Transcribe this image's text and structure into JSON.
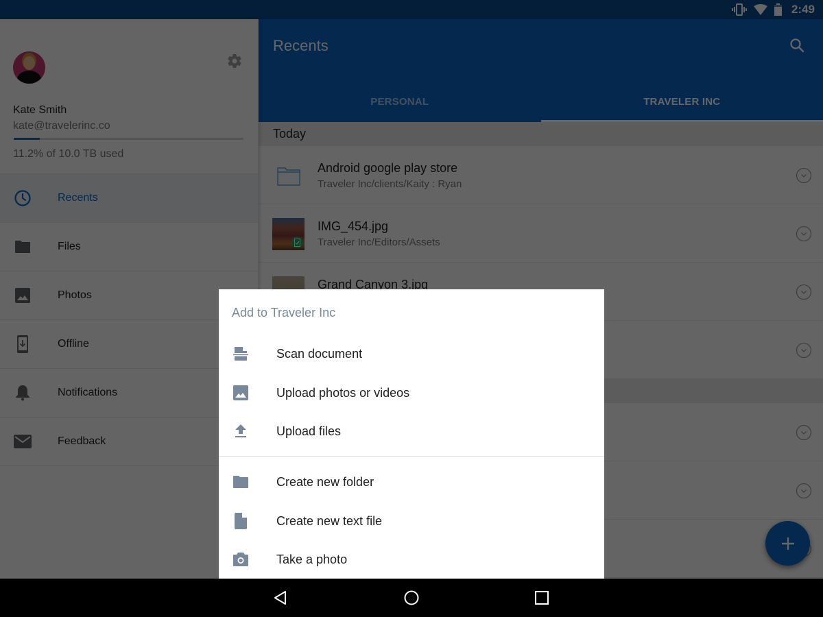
{
  "status_bar": {
    "time": "2:49",
    "icons": [
      "vibrate-icon",
      "wifi-icon",
      "battery-icon"
    ]
  },
  "sidebar": {
    "user": {
      "name": "Kate Smith",
      "email": "kate@travelerinc.co",
      "storage_text": "11.2% of 10.0 TB used",
      "storage_used_fraction": 0.112
    },
    "items": [
      {
        "label": "Recents",
        "icon": "clock-icon",
        "active": true
      },
      {
        "label": "Files",
        "icon": "folder-icon",
        "active": false
      },
      {
        "label": "Photos",
        "icon": "image-icon",
        "active": false
      },
      {
        "label": "Offline",
        "icon": "offline-device-icon",
        "active": false
      },
      {
        "label": "Notifications",
        "icon": "bell-icon",
        "active": false
      },
      {
        "label": "Feedback",
        "icon": "mail-icon",
        "active": false
      }
    ]
  },
  "main": {
    "title": "Recents",
    "tabs": [
      {
        "label": "PERSONAL",
        "active": false
      },
      {
        "label": "TRAVELER INC",
        "active": true
      }
    ],
    "sections": [
      {
        "header": "Today",
        "rows": [
          {
            "name": "Android google play store",
            "path": "Traveler Inc/clients/Kaity : Ryan",
            "type": "folder"
          },
          {
            "name": "IMG_454.jpg",
            "path": "Traveler Inc/Editors/Assets",
            "type": "image",
            "offline_badge": true
          },
          {
            "name": "Grand Canyon 3.jpg",
            "path": "",
            "type": "image"
          },
          {
            "name": "",
            "path": "",
            "type": "unknown"
          }
        ]
      },
      {
        "header": "",
        "rows": [
          {
            "name": "",
            "path": "",
            "type": "unknown"
          },
          {
            "name": "",
            "path": "",
            "type": "unknown"
          },
          {
            "name": "",
            "path": "",
            "type": "unknown"
          }
        ]
      }
    ],
    "fab_icon": "plus-icon"
  },
  "sheet": {
    "title": "Add to Traveler Inc",
    "group1": [
      {
        "label": "Scan document",
        "icon": "scan-document-icon"
      },
      {
        "label": "Upload photos or videos",
        "icon": "image-icon"
      },
      {
        "label": "Upload files",
        "icon": "upload-icon"
      }
    ],
    "group2": [
      {
        "label": "Create new folder",
        "icon": "folder-icon"
      },
      {
        "label": "Create new text file",
        "icon": "file-icon"
      },
      {
        "label": "Take a photo",
        "icon": "camera-icon"
      }
    ]
  },
  "navbar": {
    "buttons": [
      "back-icon",
      "home-icon",
      "recents-icon"
    ]
  },
  "colors": {
    "brand_blue": "#0a64c4",
    "active_nav_text": "#0a64c4",
    "sheet_icon": "#78879a",
    "sheet_title": "#78879a"
  }
}
